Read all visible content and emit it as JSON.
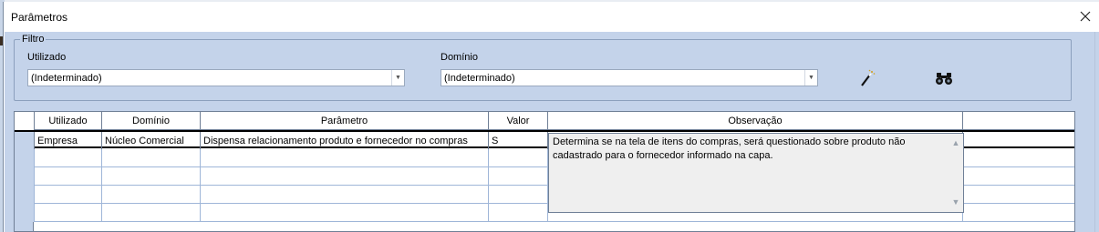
{
  "window": {
    "title": "Parâmetros"
  },
  "filter": {
    "legend": "Filtro",
    "utilizado": {
      "label": "Utilizado",
      "value": "(Indeterminado)"
    },
    "dominio": {
      "label": "Domínio",
      "value": "(Indeterminado)"
    },
    "clear_icon": "magic-wand-icon",
    "search_icon": "binoculars-icon"
  },
  "grid": {
    "columns": [
      "Utilizado",
      "Domínio",
      "Parâmetro",
      "Valor",
      "Observação",
      ""
    ],
    "rows": [
      {
        "utilizado": "Empresa",
        "dominio": "Núcleo Comercial",
        "parametro": "Dispensa relacionamento produto e fornecedor no compras",
        "valor": "S",
        "observacao": ""
      },
      {
        "utilizado": "",
        "dominio": "",
        "parametro": "",
        "valor": "",
        "observacao": ""
      },
      {
        "utilizado": "",
        "dominio": "",
        "parametro": "",
        "valor": "",
        "observacao": ""
      },
      {
        "utilizado": "",
        "dominio": "",
        "parametro": "",
        "valor": "",
        "observacao": ""
      },
      {
        "utilizado": "",
        "dominio": "",
        "parametro": "",
        "valor": "",
        "observacao": ""
      }
    ],
    "memo_text": "Determina se na tela de itens do compras, será questionado sobre produto não cadastrado para o fornecedor informado na capa."
  },
  "colors": {
    "client_bg": "#c4d3ea",
    "grid_line": "#9fb6d8"
  }
}
